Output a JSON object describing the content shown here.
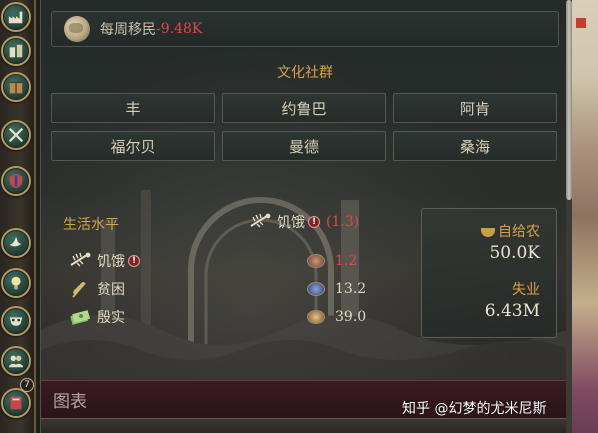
{
  "migration": {
    "label": "每周移民",
    "value": "-9.48K"
  },
  "culture": {
    "title": "文化社群",
    "items": [
      "丰",
      "约鲁巴",
      "阿肯",
      "福尔贝",
      "曼德",
      "桑海"
    ]
  },
  "standard_of_living": {
    "title": "生活水平",
    "status_label": "饥饿",
    "status_value": "(1.3)",
    "strata": [
      {
        "label": "饥饿",
        "value": "1.2",
        "icon": "fish-bones-icon",
        "warning": true
      },
      {
        "label": "贫困",
        "value": "13.2",
        "icon": "wheat-icon",
        "warning": false
      },
      {
        "label": "殷实",
        "value": "39.0",
        "icon": "money-icon",
        "warning": false
      }
    ]
  },
  "stats": {
    "subsistence_label": "自给农",
    "subsistence_value": "50.0K",
    "unemployed_label": "失业",
    "unemployed_value": "6.43M"
  },
  "chart_section": {
    "label": "图表"
  },
  "sidebar": {
    "badge_count": "7"
  },
  "watermark": "知乎 @幻梦的尤米尼斯",
  "colors": {
    "accent": "#d6a24a",
    "negative": "#e04848",
    "text": "#e2d8c0"
  }
}
